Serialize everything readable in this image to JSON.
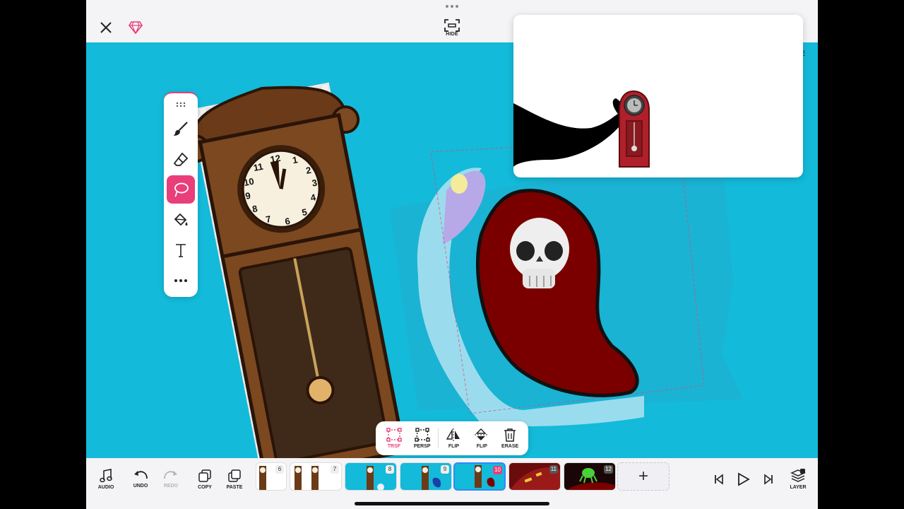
{
  "top_bar": {
    "hide_label": "HIDE",
    "page_indicator": "2"
  },
  "tools": {
    "items": [
      "drag-handle",
      "brush",
      "eraser",
      "lasso",
      "fill-bucket",
      "text",
      "more"
    ],
    "active": "lasso",
    "accent_color": "#e83f7a"
  },
  "selection_toolbar": {
    "transform_label": "TRSF",
    "perspective_label": "PERSP",
    "flip_h_label": "FLIP",
    "flip_v_label": "FLIP",
    "erase_label": "ERASE"
  },
  "bottom_bar": {
    "audio_label": "AUDIO",
    "undo_label": "UNDO",
    "redo_label": "REDO",
    "copy_label": "COPY",
    "paste_label": "PASTE",
    "layer_label": "LAYER",
    "add_frame_label": "+"
  },
  "frames": [
    {
      "number": "6",
      "selected": false
    },
    {
      "number": "7",
      "selected": false
    },
    {
      "number": "8",
      "selected": false
    },
    {
      "number": "9",
      "selected": false
    },
    {
      "number": "10",
      "selected": true
    },
    {
      "number": "11",
      "selected": false
    },
    {
      "number": "12",
      "selected": false
    }
  ],
  "colors": {
    "canvas_background": "#13bad9",
    "accent": "#e83f7a",
    "selected_frame_border": "#2c8cf4"
  }
}
